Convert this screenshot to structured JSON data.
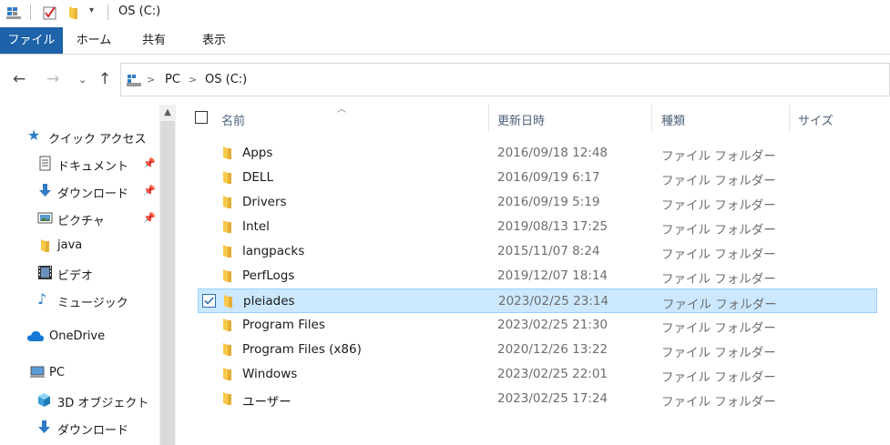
{
  "window": {
    "title": "OS (C:)"
  },
  "quick_access_toolbar": [
    "properties-icon",
    "checkmark-icon",
    "new-folder-icon",
    "dropdown-arrow-icon"
  ],
  "ribbon": {
    "tabs": [
      {
        "label": "ファイル",
        "active": true
      },
      {
        "label": "ホーム"
      },
      {
        "label": "共有"
      },
      {
        "label": "表示"
      }
    ]
  },
  "address": {
    "segments": [
      "PC",
      "OS (C:)"
    ],
    "separator": ">"
  },
  "nav_pane": {
    "items": [
      {
        "label": "クイック アクセス",
        "icon": "star-icon"
      },
      {
        "label": "ドキュメント",
        "icon": "document-icon",
        "pinned": true
      },
      {
        "label": "ダウンロード",
        "icon": "download-icon",
        "pinned": true
      },
      {
        "label": "ピクチャ",
        "icon": "picture-icon",
        "pinned": true
      },
      {
        "label": "java",
        "icon": "folder-icon"
      },
      {
        "label": "ビデオ",
        "icon": "video-icon"
      },
      {
        "label": "ミュージック",
        "icon": "music-icon"
      },
      {
        "label": "OneDrive",
        "icon": "cloud-icon"
      },
      {
        "label": "PC",
        "icon": "computer-icon"
      },
      {
        "label": "3D オブジェクト",
        "icon": "cube-icon"
      },
      {
        "label": "ダウンロード",
        "icon": "download-icon"
      }
    ]
  },
  "file_list": {
    "columns": [
      "名前",
      "更新日時",
      "種類",
      "サイズ"
    ],
    "rows": [
      {
        "name": "Apps",
        "date": "2016/09/18 12:48",
        "type": "ファイル フォルダー"
      },
      {
        "name": "DELL",
        "date": "2016/09/19 6:17",
        "type": "ファイル フォルダー"
      },
      {
        "name": "Drivers",
        "date": "2016/09/19 5:19",
        "type": "ファイル フォルダー"
      },
      {
        "name": "Intel",
        "date": "2019/08/13 17:25",
        "type": "ファイル フォルダー"
      },
      {
        "name": "langpacks",
        "date": "2015/11/07 8:24",
        "type": "ファイル フォルダー"
      },
      {
        "name": "PerfLogs",
        "date": "2019/12/07 18:14",
        "type": "ファイル フォルダー"
      },
      {
        "name": "pleiades",
        "date": "2023/02/25 23:14",
        "type": "ファイル フォルダー",
        "selected": true
      },
      {
        "name": "Program Files",
        "date": "2023/02/25 21:30",
        "type": "ファイル フォルダー"
      },
      {
        "name": "Program Files (x86)",
        "date": "2020/12/26 13:22",
        "type": "ファイル フォルダー"
      },
      {
        "name": "Windows",
        "date": "2023/02/25 22:01",
        "type": "ファイル フォルダー"
      },
      {
        "name": "ユーザー",
        "date": "2023/02/25 17:24",
        "type": "ファイル フォルダー"
      }
    ]
  },
  "colors": {
    "file_tab_bg": "#1e62a9",
    "selection_bg": "#cce8ff",
    "selection_border": "#99d1ff",
    "folder_yellow": "#f8c94a",
    "header_text": "#4c607a"
  }
}
